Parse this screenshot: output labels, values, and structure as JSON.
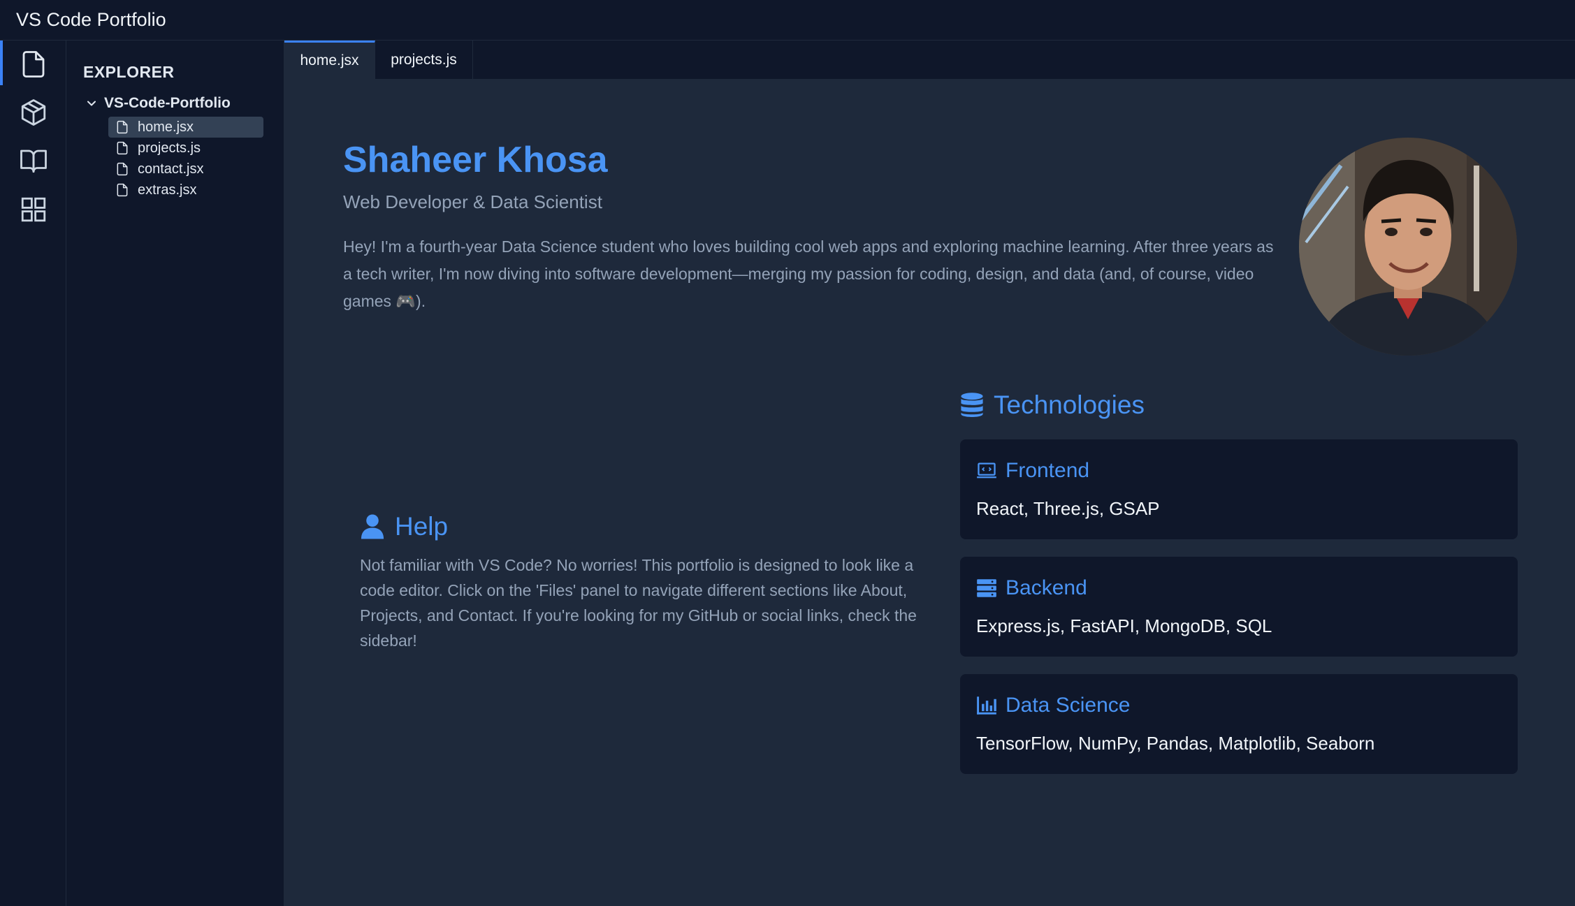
{
  "window": {
    "title": "VS Code Portfolio"
  },
  "activity_bar": {
    "items": [
      {
        "name": "files",
        "icon": "file-icon",
        "active": true
      },
      {
        "name": "projects",
        "icon": "package-icon",
        "active": false
      },
      {
        "name": "docs",
        "icon": "book-icon",
        "active": false
      },
      {
        "name": "extras",
        "icon": "grid-icon",
        "active": false
      }
    ]
  },
  "explorer": {
    "title": "EXPLORER",
    "folder": "VS-Code-Portfolio",
    "files": [
      {
        "label": "home.jsx",
        "active": true
      },
      {
        "label": "projects.js",
        "active": false
      },
      {
        "label": "contact.jsx",
        "active": false
      },
      {
        "label": "extras.jsx",
        "active": false
      }
    ]
  },
  "tabs": [
    {
      "label": "home.jsx",
      "active": true
    },
    {
      "label": "projects.js",
      "active": false
    }
  ],
  "hero": {
    "name": "Shaheer Khosa",
    "role": "Web Developer & Data Scientist",
    "bio": "Hey! I'm a fourth-year Data Science student who loves building cool web apps and exploring machine learning. After three years as a tech writer, I'm now diving into software development—merging my passion for coding, design, and data (and, of course, video games 🎮).",
    "avatar_icon": "profile-photo"
  },
  "help": {
    "title": "Help",
    "icon": "user-icon",
    "text": "Not familiar with VS Code? No worries! This portfolio is designed to look like a code editor. Click on the 'Files' panel to navigate different sections like About, Projects, and Contact. If you're looking for my GitHub or social links, check the sidebar!"
  },
  "technologies": {
    "title": "Technologies",
    "icon": "database-icon",
    "cards": [
      {
        "title": "Frontend",
        "icon": "laptop-code-icon",
        "items": "React, Three.js, GSAP"
      },
      {
        "title": "Backend",
        "icon": "server-icon",
        "items": "Express.js, FastAPI, MongoDB, SQL"
      },
      {
        "title": "Data Science",
        "icon": "bar-chart-icon",
        "items": "TensorFlow, NumPy, Pandas, Matplotlib, Seaborn"
      }
    ]
  },
  "colors": {
    "accent": "#4a94f4",
    "background": "#1e293b",
    "panel": "#0f172a",
    "muted_text": "#94a3b8",
    "text": "#f1f5f9"
  }
}
